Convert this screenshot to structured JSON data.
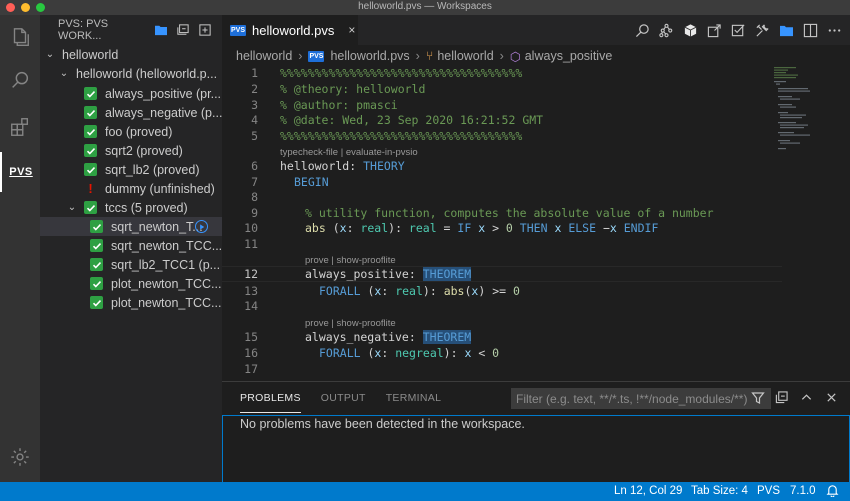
{
  "window": {
    "title": "helloworld.pvs — Workspaces"
  },
  "activity_bar": {
    "items": [
      "explorer-icon",
      "search-icon",
      "extensions-icon",
      "pvs-icon",
      "gear-icon"
    ],
    "pvs_label": "PVS"
  },
  "sidebar": {
    "title": "PVS: PVS WORK...",
    "tree": [
      {
        "label": "helloworld",
        "kind": "root"
      },
      {
        "label": "helloworld  (helloworld.p...",
        "kind": "theory"
      },
      {
        "label": "always_positive  (pr...",
        "kind": "proved"
      },
      {
        "label": "always_negative  (p...",
        "kind": "proved"
      },
      {
        "label": "foo  (proved)",
        "kind": "proved"
      },
      {
        "label": "sqrt2  (proved)",
        "kind": "proved"
      },
      {
        "label": "sqrt_lb2  (proved)",
        "kind": "proved"
      },
      {
        "label": "dummy  (unfinished)",
        "kind": "unfinished"
      },
      {
        "label": "tccs  (5 proved)",
        "kind": "group"
      },
      {
        "label": "sqrt_newton_T...",
        "kind": "tcc"
      },
      {
        "label": "sqrt_newton_TCC...",
        "kind": "tcc"
      },
      {
        "label": "sqrt_lb2_TCC1  (p...",
        "kind": "tcc"
      },
      {
        "label": "plot_newton_TCC...",
        "kind": "tcc"
      },
      {
        "label": "plot_newton_TCC...",
        "kind": "tcc"
      }
    ]
  },
  "editor": {
    "tab": {
      "icon_text": "PVS",
      "label": "helloworld.pvs",
      "close": "×"
    },
    "breadcrumb": {
      "workspace": "helloworld",
      "file": "helloworld.pvs",
      "theory": "helloworld",
      "formula": "always_positive"
    },
    "codelens": {
      "c1": "typecheck-file | evaluate-in-pvsio",
      "c2": "prove | show-prooflite",
      "c3": "prove | show-prooflite"
    },
    "lines": {
      "n1": "1",
      "n2": "2",
      "n3": "3",
      "n4": "4",
      "n5": "5",
      "n6": "6",
      "n7": "7",
      "n8": "8",
      "n9": "9",
      "n10": "10",
      "n11": "11",
      "n12": "12",
      "n13": "13",
      "n14": "14",
      "n15": "15",
      "n16": "16",
      "n17": "17",
      "l1": "%%%%%%%%%%%%%%%%%%%%%%%%%%%%%%%%%%%",
      "l2": "% @theory: helloworld",
      "l3": "% @author: pmasci",
      "l4": "% @date: Wed, 23 Sep 2020 16:21:52 GMT",
      "l5": "%%%%%%%%%%%%%%%%%%%%%%%%%%%%%%%%%%%",
      "l9": "% utility function, computes the absolute value of a number"
    },
    "tokens": {
      "theory_name": "helloworld",
      "colon": ":",
      "THEORY": "THEORY",
      "BEGIN": "BEGIN",
      "abs": "abs",
      "real": "real",
      "IF": "IF",
      "THEN": "THEN",
      "ELSE": "ELSE",
      "ENDIF": "ENDIF",
      "always_positive": "always_positive",
      "always_negative": "always_negative",
      "THEOREM": "THEOREM",
      "FORALL": "FORALL",
      "negreal": "negreal",
      "zero": "0",
      "x": "x"
    }
  },
  "panel": {
    "tabs": [
      "PROBLEMS",
      "OUTPUT",
      "TERMINAL"
    ],
    "filter_placeholder": "Filter (e.g. text, **/*.ts, !**/node_modules/**)",
    "message": "No problems have been detected in the workspace."
  },
  "statusbar": {
    "position": "Ln 12, Col 29",
    "tab_size": "Tab Size: 4",
    "language": "PVS",
    "version": "7.1.0"
  },
  "colors": {
    "accent": "#007acc",
    "proved": "#2ea043",
    "unfinished": "#e51400"
  }
}
